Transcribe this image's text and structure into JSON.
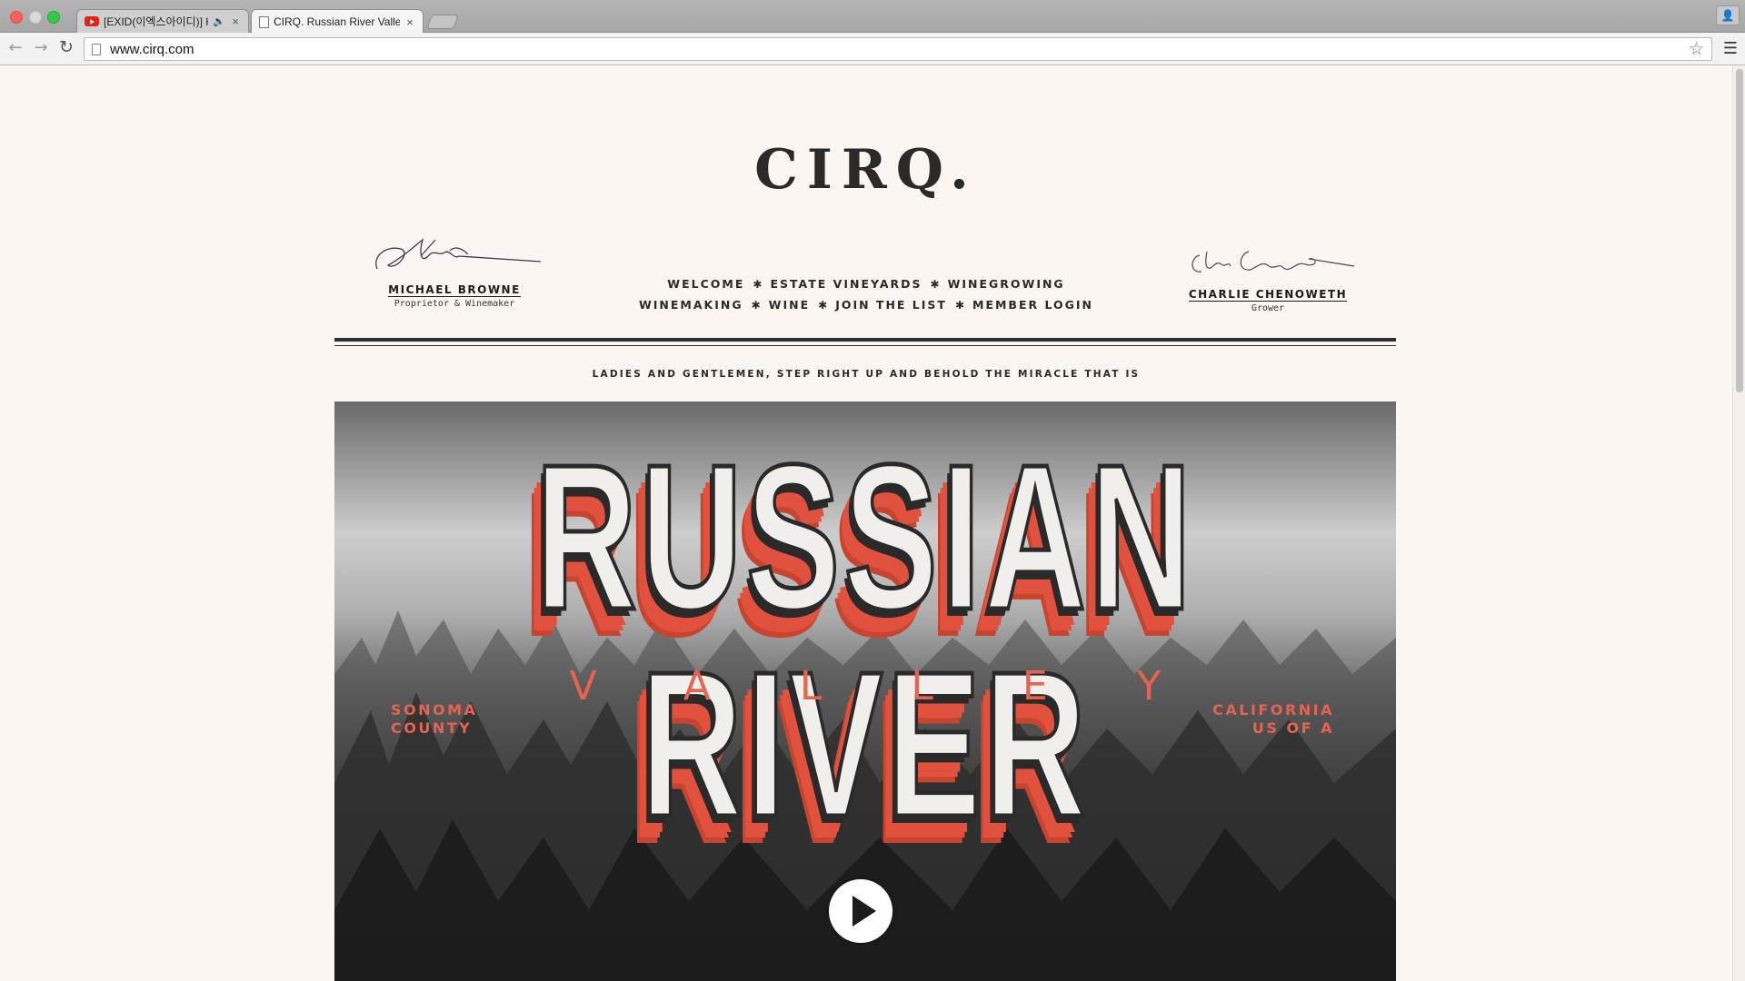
{
  "browser": {
    "tabs": [
      {
        "title": "[EXID(이엑스아이디)] HOT",
        "icon": "youtube-icon",
        "audio": true
      },
      {
        "title": "CIRQ. Russian River Valley",
        "icon": "page-icon",
        "active": true
      }
    ],
    "url": "www.cirq.com"
  },
  "site": {
    "logo": "CIRQ.",
    "left_person": {
      "name": "MICHAEL BROWNE",
      "role": "Proprietor & Winemaker"
    },
    "right_person": {
      "name": "CHARLIE CHENOWETH",
      "role": "Grower"
    },
    "nav": {
      "row1": [
        "WELCOME",
        "ESTATE VINEYARDS",
        "WINEGROWING"
      ],
      "row2": [
        "WINEMAKING",
        "WINE",
        "JOIN THE LIST",
        "MEMBER LOGIN"
      ],
      "separator": "✱"
    },
    "tagline": "LADIES AND GENTLEMEN, STEP RIGHT UP AND BEHOLD THE MIRACLE THAT IS",
    "hero": {
      "title": "RUSSIAN RIVER",
      "subtitle": "VALLEY",
      "left": [
        "SONOMA",
        "COUNTY"
      ],
      "right": [
        "CALIFORNIA",
        "US OF A"
      ],
      "accent_color": "#e8634f"
    }
  }
}
